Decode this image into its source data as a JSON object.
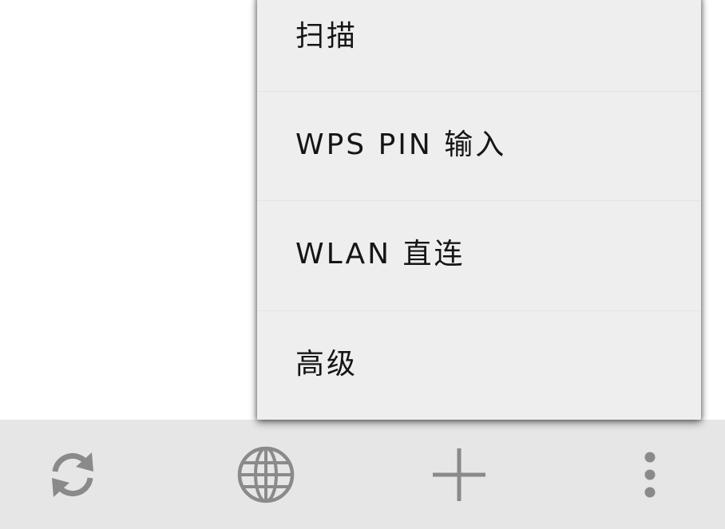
{
  "menu": {
    "items": [
      {
        "label": "扫描"
      },
      {
        "label": "WPS PIN 输入"
      },
      {
        "label": "WLAN 直连"
      },
      {
        "label": "高级"
      }
    ]
  },
  "bottom_bar": {
    "icons": [
      "refresh-icon",
      "globe-icon",
      "add-icon",
      "more-vert-icon"
    ],
    "icon_color": "#8a8a8a",
    "background": "#e6e6e6"
  },
  "colors": {
    "menu_background": "#eeeeee",
    "menu_text": "#151515",
    "page_background": "#ffffff"
  }
}
